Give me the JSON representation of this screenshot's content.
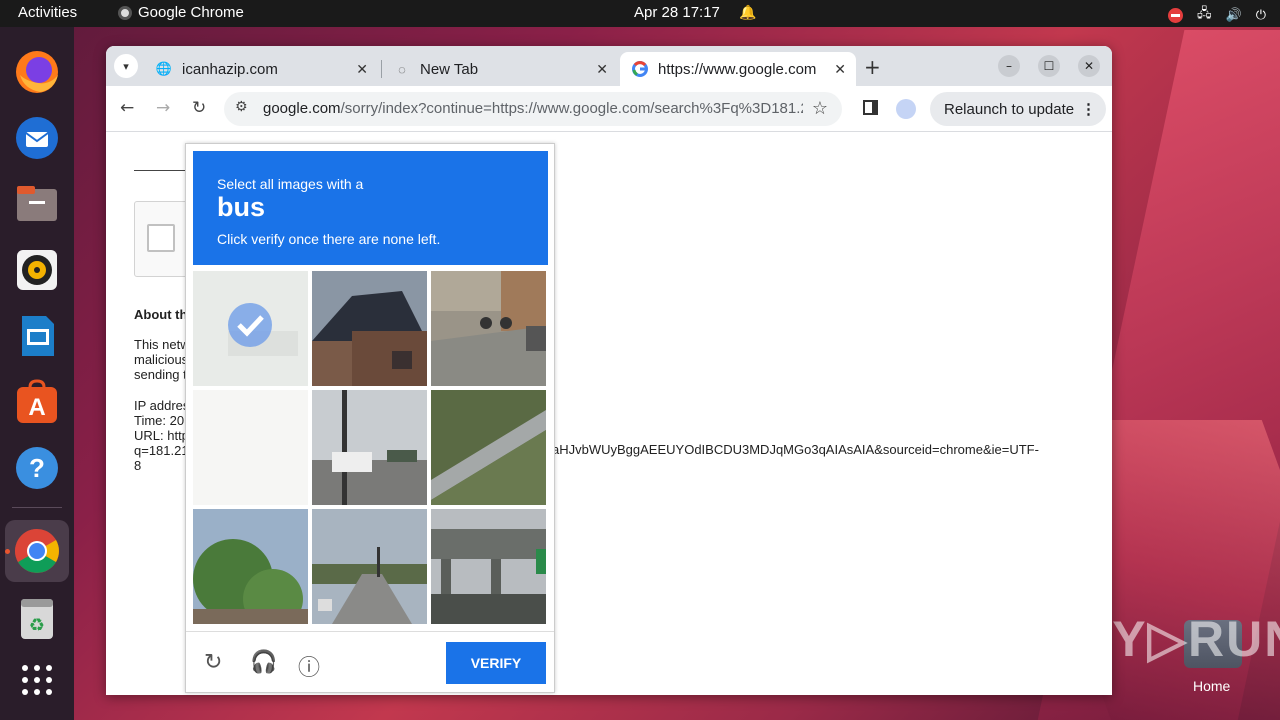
{
  "topbar": {
    "activities": "Activities",
    "app_name": "Google Chrome",
    "clock": "Apr 28  17:17"
  },
  "tabs": [
    {
      "title": "icanhazip.com",
      "icon": "globe-icon"
    },
    {
      "title": "New Tab",
      "icon": "loading-icon"
    },
    {
      "title": "https://www.google.com",
      "icon": "google-icon"
    }
  ],
  "toolbar": {
    "url_host": "google.com",
    "url_path": "/sorry/index?continue=https://www.google.com/search%3Fq%3D181.2...",
    "relaunch": "Relaunch to update"
  },
  "page": {
    "about": "About th",
    "para1": [
      "This netw",
      "malicious",
      "sending t"
    ],
    "para2": [
      "IP addres",
      "Time: 20",
      "URL: http",
      "q=181.21",
      "8"
    ],
    "url_rest": "aHJvbWUyBggAEEUYOdIBCDU3MDJqMGo3qAIAsAIA&sourceid=chrome&ie=UTF-"
  },
  "captcha": {
    "line1": "Select all images with a",
    "target": "bus",
    "line3": "Click verify once there are none left.",
    "verify": "VERIFY"
  },
  "desktop": {
    "home_label": "Home",
    "watermark": "ANY▷RUN"
  }
}
